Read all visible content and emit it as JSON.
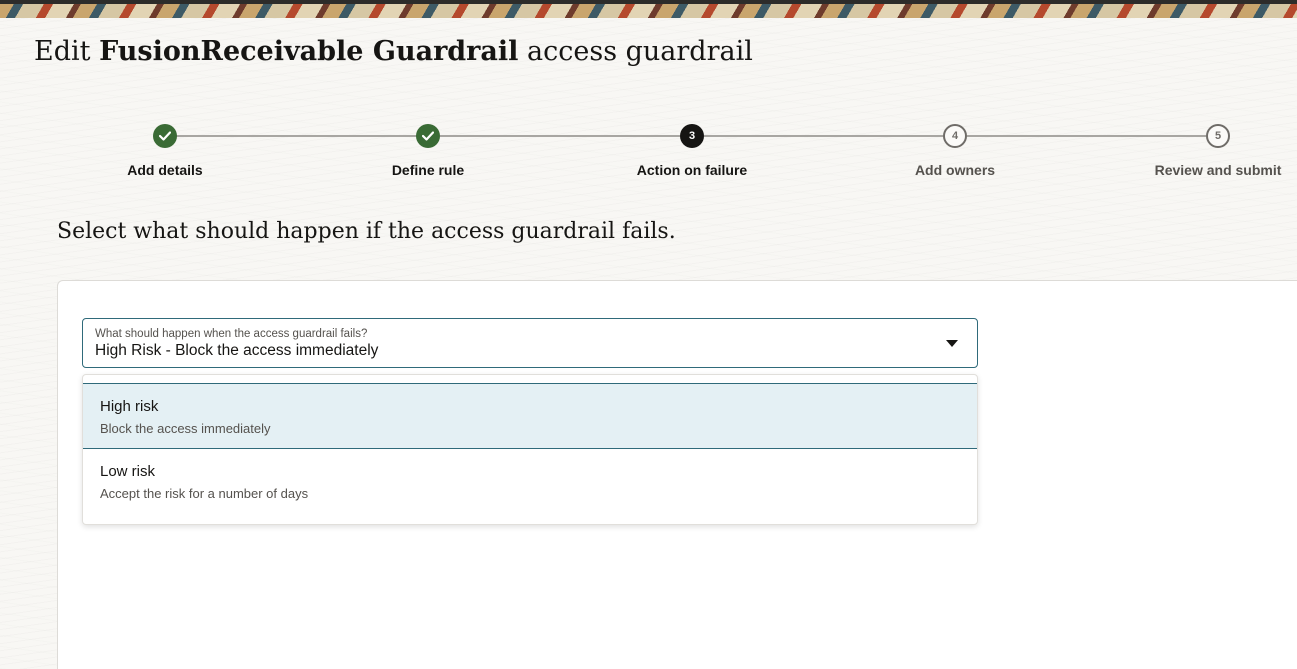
{
  "title": {
    "prefix": "Edit",
    "name": "FusionReceivable Guardrail",
    "suffix": "access guardrail"
  },
  "stepper": {
    "steps": [
      {
        "number": "1",
        "label": "Add details",
        "state": "done"
      },
      {
        "number": "2",
        "label": "Define rule",
        "state": "done"
      },
      {
        "number": "3",
        "label": "Action on failure",
        "state": "current"
      },
      {
        "number": "4",
        "label": "Add owners",
        "state": "todo"
      },
      {
        "number": "5",
        "label": "Review and submit",
        "state": "todo"
      }
    ],
    "colors": {
      "done": "#3a6b35",
      "current": "#161513",
      "todo": "#6f6c68"
    }
  },
  "section": {
    "heading": "Select what should happen if the access guardrail fails."
  },
  "failure_select": {
    "label": "What should happen when the access guardrail fails?",
    "value": "High Risk - Block the access immediately",
    "icon": "chevron-down-icon",
    "options": [
      {
        "title": "High risk",
        "description": "Block the access immediately",
        "selected": true
      },
      {
        "title": "Low risk",
        "description": "Accept the risk for a number of days",
        "selected": false
      }
    ]
  },
  "colors": {
    "accent": "#2f6a7a",
    "selected_option_bg": "#e4f0f4"
  }
}
